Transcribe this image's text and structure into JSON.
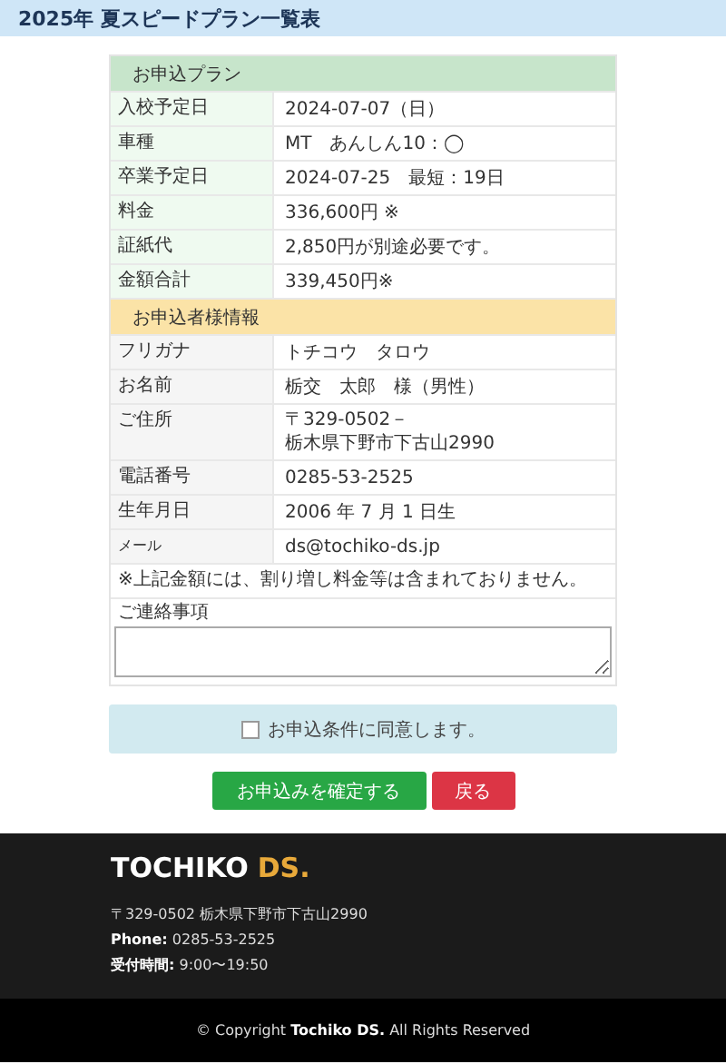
{
  "page_title": "2025年 夏スピードプラン一覧表",
  "sections": [
    {
      "kind": "plan",
      "title": "お申込プラン",
      "rows": [
        {
          "label": "入校予定日",
          "value": [
            "2024-07-07（日）"
          ]
        },
        {
          "label": "車種",
          "value": [
            "MT　あんしん10：◯"
          ]
        },
        {
          "label": "卒業予定日",
          "value": [
            "2024-07-25　最短：19日"
          ]
        },
        {
          "label": "料金",
          "value": [
            "336,600円 ※"
          ]
        },
        {
          "label": "証紙代",
          "value": [
            "2,850円が別途必要です。"
          ]
        },
        {
          "label": "金額合計",
          "value": [
            "339,450円※"
          ]
        }
      ]
    },
    {
      "kind": "applicant",
      "title": "お申込者様情報",
      "rows": [
        {
          "label": "フリガナ",
          "value": [
            "トチコウ　タロウ"
          ]
        },
        {
          "label": "お名前",
          "value": [
            "栃交　太郎　様（男性）"
          ]
        },
        {
          "label": "ご住所",
          "value": [
            "〒329-0502－",
            "栃木県下野市下古山2990"
          ]
        },
        {
          "label": "電話番号",
          "value": [
            "0285-53-2525"
          ]
        },
        {
          "label": "生年月日",
          "value": [
            "2006 年 7 月 1 日生"
          ]
        },
        {
          "label": "メール",
          "small": true,
          "value": [
            "ds@tochiko-ds.jp"
          ]
        }
      ]
    }
  ],
  "note": "※上記金額には、割り増し料金等は含まれておりません。",
  "contact": {
    "label": "ご連絡事項"
  },
  "agree": {
    "label": "お申込条件に同意します。",
    "checked": false
  },
  "buttons": [
    {
      "kind": "confirm",
      "label": "お申込みを確定する"
    },
    {
      "kind": "back",
      "label": "戻る"
    }
  ],
  "footer": {
    "logo_main": "TOCHIKO",
    "logo_accent": "DS.",
    "lines": [
      "〒329-0502 栃木県下野市下古山2990",
      "**Phone:** 0285-53-2525",
      "**受付時間:** 9:00〜19:50"
    ],
    "copyright": "© Copyright **Tochiko DS.** All Rights Reserved"
  }
}
